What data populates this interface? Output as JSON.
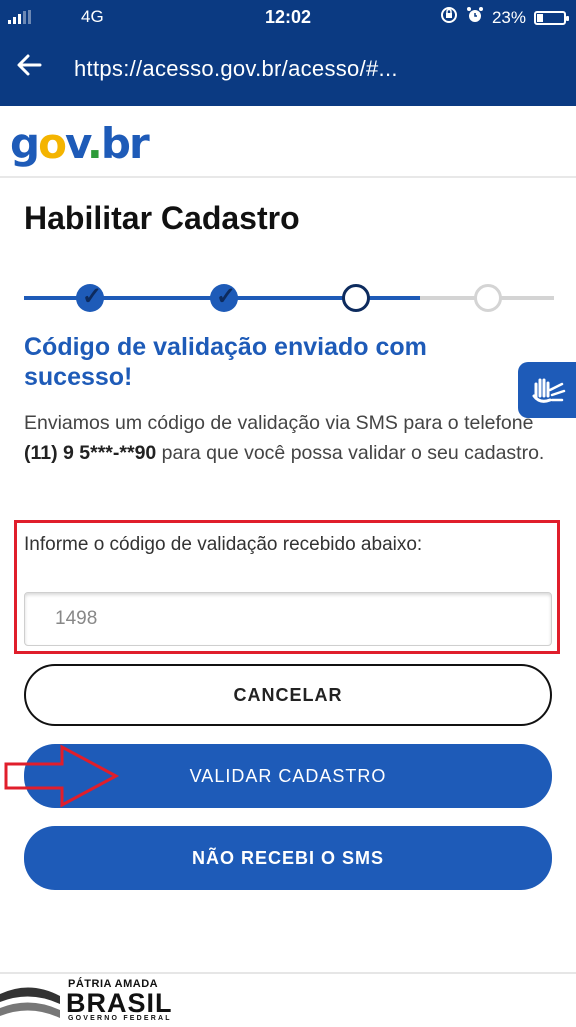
{
  "status_bar": {
    "network": "4G",
    "time": "12:02",
    "battery": "23%",
    "battery_level": 0.23,
    "icons": [
      "signal-icon",
      "rotation-lock-icon",
      "alarm-icon",
      "battery-icon"
    ]
  },
  "browser": {
    "back_icon": "arrow-left-icon",
    "url": "https://acesso.gov.br/acesso/#..."
  },
  "logo": {
    "text": "gov.br"
  },
  "page": {
    "title": "Habilitar Cadastro",
    "stepper": {
      "total_steps": 4,
      "completed": 2,
      "current": 3
    },
    "success_message": "Código de validação enviado com sucesso!",
    "description": {
      "before": "Enviamos um código de validação via SMS para o telefone ",
      "phone": "(11) 9 5***-**90",
      "after": " para que você possa validar o seu cadastro."
    },
    "code_field": {
      "label": "Informe o código de validação recebido abaixo:",
      "value": "1498"
    },
    "buttons": {
      "cancel": "CANCELAR",
      "validate": "VALIDAR CADASTRO",
      "no_sms": "NÃO RECEBI O SMS"
    }
  },
  "accessibility_widget": {
    "icon": "sign-language-hands-icon"
  },
  "footer": {
    "line1": "PÁTRIA AMADA",
    "line2": "BRASIL",
    "line3": "GOVERNO FEDERAL"
  },
  "colors": {
    "header_bg": "#0b3a82",
    "primary": "#1e5bb8",
    "highlight_red": "#e01e2b"
  }
}
